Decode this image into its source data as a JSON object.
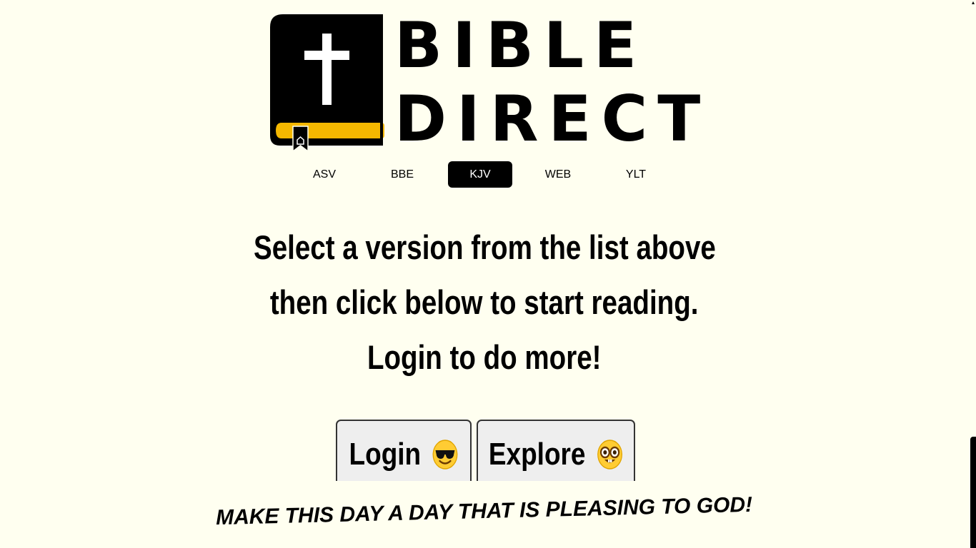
{
  "logo": {
    "line1": "BIBLE",
    "line2": "DIRECT",
    "icon": "bible-book-cross-icon"
  },
  "versions": [
    {
      "label": "ASV",
      "active": false
    },
    {
      "label": "BBE",
      "active": false
    },
    {
      "label": "KJV",
      "active": true
    },
    {
      "label": "WEB",
      "active": false
    },
    {
      "label": "YLT",
      "active": false
    }
  ],
  "headline": {
    "line1": "Select a version from the list above",
    "line2": "then click below to start reading.",
    "line3": "Login to do more!"
  },
  "buttons": {
    "login_label": "Login",
    "login_icon": "sunglasses-face-icon",
    "explore_label": "Explore",
    "explore_icon": "nerd-face-icon"
  },
  "footer": {
    "message": "MAKE THIS DAY A DAY THAT IS PLEASING TO GOD!"
  },
  "colors": {
    "background": "#fffff0",
    "accent": "#f5b800",
    "active_tab": "#000000"
  }
}
